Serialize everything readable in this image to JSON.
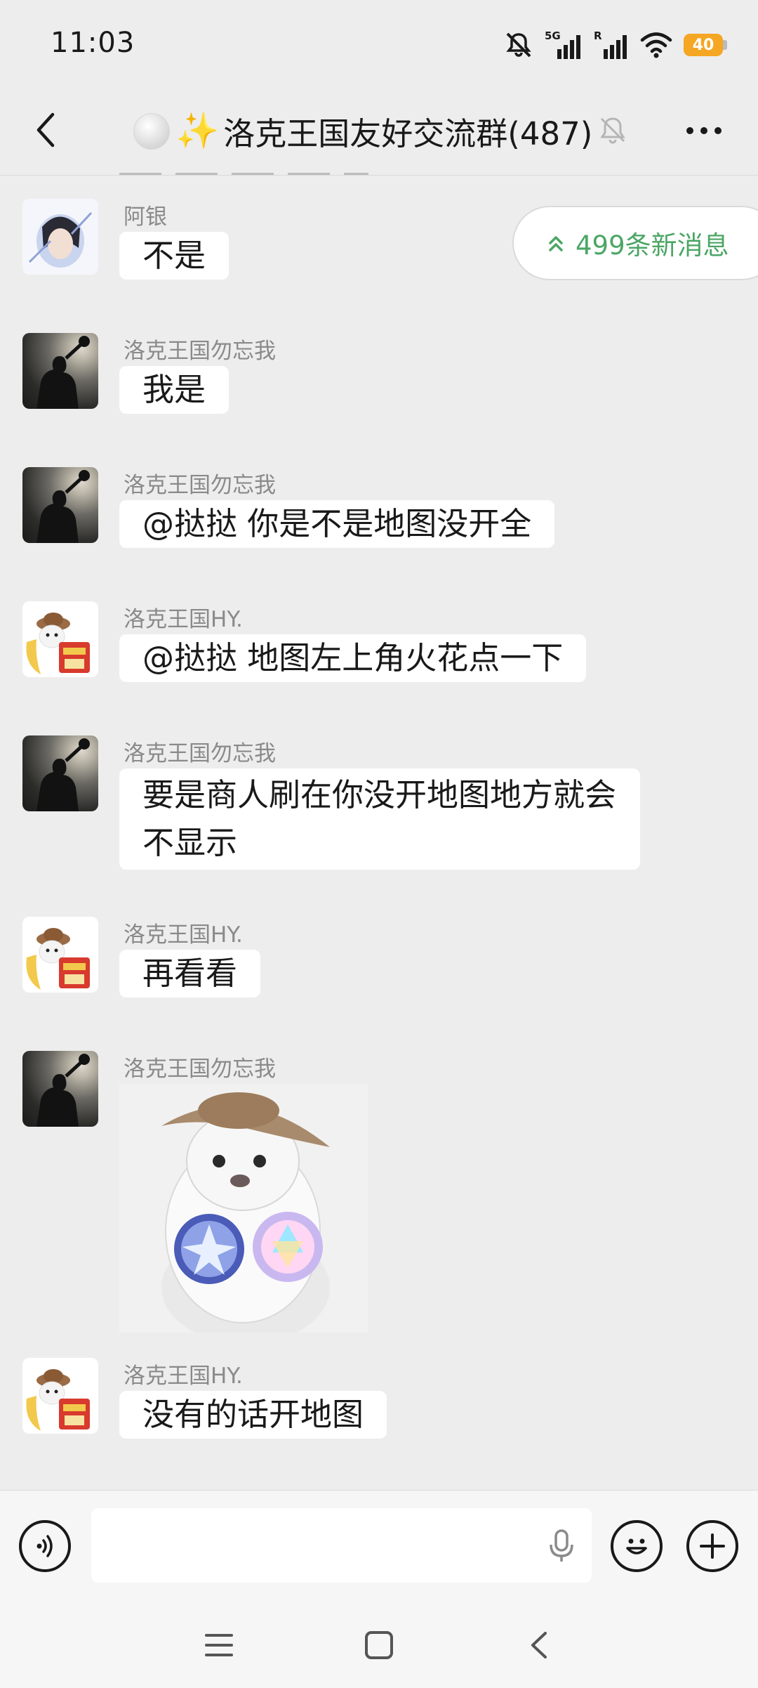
{
  "status_bar": {
    "time": "11:03",
    "network_label": "5G",
    "roaming_label": "R",
    "battery_level": "40"
  },
  "header": {
    "title": "洛克王国友好交流群(487)",
    "title_emoji": "✨"
  },
  "new_messages": {
    "label": "499条新消息"
  },
  "messages": [
    {
      "sender": "阿银",
      "text": "不是",
      "avatar": "anime-avatar"
    },
    {
      "sender": "洛克王国勿忘我",
      "text": "我是",
      "avatar": "silhouette-avatar"
    },
    {
      "sender": "洛克王国勿忘我",
      "text": "@挞挞  你是不是地图没开全",
      "avatar": "silhouette-avatar"
    },
    {
      "sender": "洛克王国HY.",
      "text": "@挞挞  地图左上角火花点一下",
      "avatar": "cat-avatar"
    },
    {
      "sender": "洛克王国勿忘我",
      "text": "要是商人刷在你没开地图地方就会不显示",
      "avatar": "silhouette-avatar"
    },
    {
      "sender": "洛克王国HY.",
      "text": "再看看",
      "avatar": "cat-avatar"
    },
    {
      "sender": "洛克王国勿忘我",
      "text": "",
      "avatar": "silhouette-avatar",
      "sticker": "cat-with-hat-holding-crystals"
    },
    {
      "sender": "洛克王国HY.",
      "text": "没有的话开地图",
      "avatar": "cat-avatar"
    }
  ],
  "colors": {
    "background": "#ededed",
    "bubble": "#ffffff",
    "accent_green": "#4ba665",
    "battery": "#f5a623"
  }
}
